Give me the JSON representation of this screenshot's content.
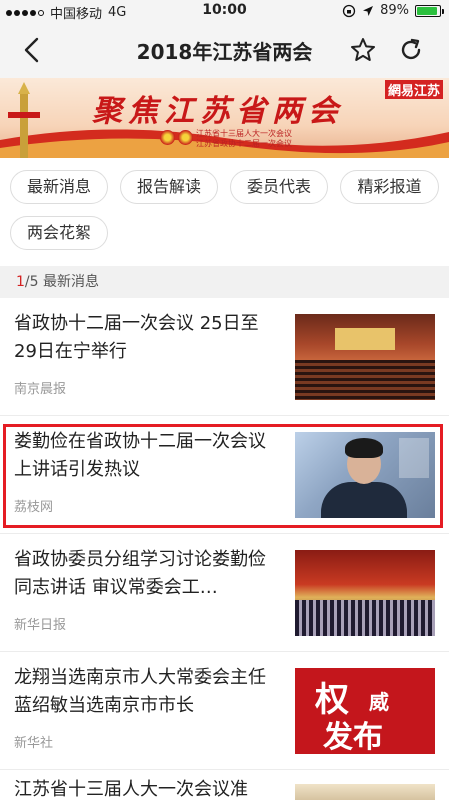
{
  "status_bar": {
    "carrier": "中国移动",
    "network": "4G",
    "time": "10:00",
    "battery": "89%",
    "battery_level": 0.89
  },
  "nav": {
    "title": "2018年江苏省两会",
    "back_icon": "chevron-left-icon",
    "favorite_icon": "star-icon",
    "share_icon": "share-icon"
  },
  "banner": {
    "title": "聚焦江苏省两会",
    "subtitle_line1": "江苏省十三届人大一次会议",
    "subtitle_line2": "江苏省政协十二届一次会议",
    "logo": "網易江苏"
  },
  "tabs": [
    {
      "label": "最新消息"
    },
    {
      "label": "报告解读"
    },
    {
      "label": "委员代表"
    },
    {
      "label": "精彩报道"
    },
    {
      "label": "两会花絮"
    }
  ],
  "section": {
    "current": "1",
    "total": "/5",
    "label": "最新消息"
  },
  "news": [
    {
      "title": "省政协十二届一次会议 25日至29日在宁举行",
      "source": "南京晨报"
    },
    {
      "title": "娄勤俭在省政协十二届一次会议上讲话引发热议",
      "source": "荔枝网"
    },
    {
      "title": "省政协委员分组学习讨论娄勤俭同志讲话 审议常委会工…",
      "source": "新华日报"
    },
    {
      "title": "龙翔当选南京市人大常委会主任 蓝绍敏当选南京市市长",
      "source": "新华社",
      "thumb_big": "权",
      "thumb_small": "威",
      "thumb_big2": "发布"
    },
    {
      "title": "江苏省十三届人大一次会议准",
      "source": ""
    }
  ],
  "colors": {
    "accent_red": "#d42222",
    "highlight": "#e51c23",
    "battery_green": "#2bc03e"
  }
}
